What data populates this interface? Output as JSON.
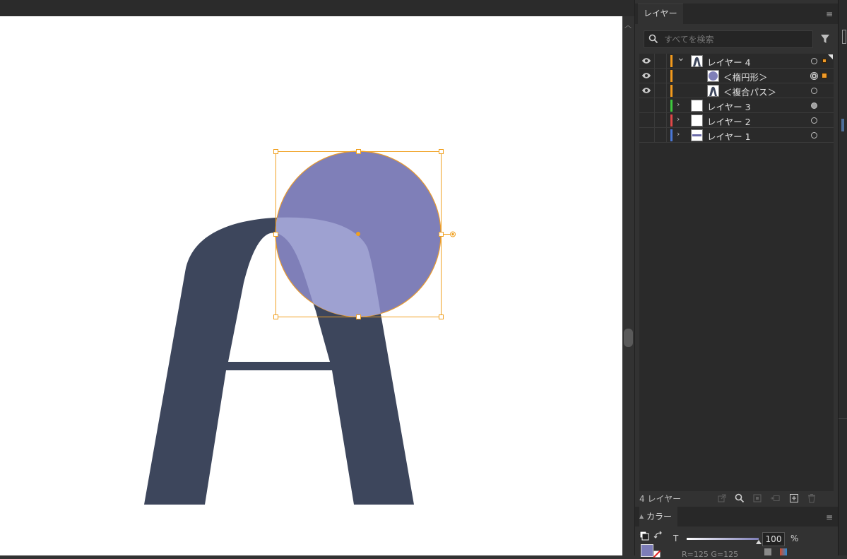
{
  "app": {
    "collapse_glyph": "»"
  },
  "artwork": {
    "letter_color": "#3d465c",
    "ellipse_fill": "#7f7fb8",
    "ellipse_stroke": "#e89a2f",
    "overlap_fill": "#9ea1d1",
    "selection_color": "#f0a020"
  },
  "layers_panel": {
    "tab_label": "レイヤー",
    "search_placeholder": "すべてを検索",
    "layers": [
      {
        "label": "レイヤー 4",
        "color": "#f39a1c",
        "visible": true,
        "expanded": true,
        "indent": 0,
        "thumb": "letter-a",
        "target": "hollow",
        "selected": true
      },
      {
        "label": "＜楕円形＞",
        "color": "#f39a1c",
        "visible": true,
        "expanded": false,
        "indent": 1,
        "thumb": "ellipse",
        "target": "double",
        "selected": true
      },
      {
        "label": "＜複合パス＞",
        "color": "#f39a1c",
        "visible": true,
        "expanded": false,
        "indent": 1,
        "thumb": "letter-a",
        "target": "hollow",
        "selected": false
      },
      {
        "label": "レイヤー 3",
        "color": "#3ec93e",
        "visible": false,
        "expanded": false,
        "indent": 0,
        "thumb": "blank",
        "target": "filled",
        "selected": false
      },
      {
        "label": "レイヤー 2",
        "color": "#e04848",
        "visible": false,
        "expanded": false,
        "indent": 0,
        "thumb": "blank",
        "target": "hollow",
        "selected": false
      },
      {
        "label": "レイヤー 1",
        "color": "#4a78d8",
        "visible": false,
        "expanded": false,
        "indent": 0,
        "thumb": "text",
        "target": "hollow",
        "selected": false
      }
    ],
    "footer_count": "4 レイヤー"
  },
  "color_panel": {
    "tab_label": "カラー",
    "tint_label": "T",
    "tint_value": "100",
    "percent": "%",
    "partial_readout": "R=125 G=125",
    "fill_color": "#7d7db8"
  }
}
